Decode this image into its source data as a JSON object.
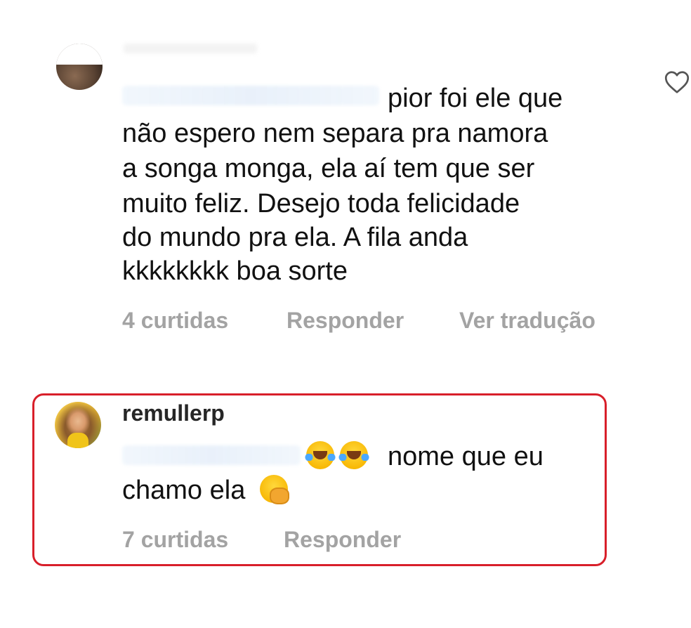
{
  "comments": [
    {
      "username": "",
      "mention": "",
      "lines": [
        "pior foi ele que",
        "não espero nem separa pra namora",
        "a songa monga, ela aí tem que ser",
        "muito feliz. Desejo toda felicidade",
        "do mundo pra ela. A fila anda",
        "kkkkkkkk boa sorte"
      ],
      "likes": "4 curtidas",
      "reply": "Responder",
      "translate": "Ver tradução",
      "icon": "heart-icon"
    },
    {
      "username": "remullerp",
      "mention": "",
      "line1_text": "nome que eu",
      "line2_text": "chamo ela",
      "emojis": [
        "face-with-tears-of-joy",
        "face-with-tears-of-joy",
        "face-with-hand-over-mouth"
      ],
      "likes": "7 curtidas",
      "reply": "Responder",
      "highlight_color": "#d81f2a"
    }
  ]
}
